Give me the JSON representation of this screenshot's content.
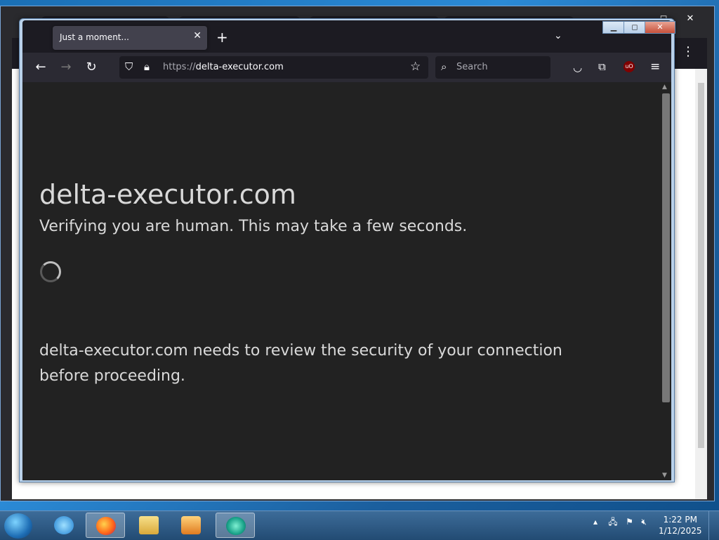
{
  "browser": {
    "tab": {
      "title": "Just a moment..."
    },
    "url": {
      "protocol": "https://",
      "domain": "delta-executor.com"
    },
    "search": {
      "placeholder": "Search"
    }
  },
  "page": {
    "heading": "delta-executor.com",
    "subheading": "Verifying you are human. This may take a few seconds.",
    "note": "delta-executor.com needs to review the security of your connection before proceeding."
  },
  "taskbar": {
    "clock_time": "1:22 PM",
    "clock_date": "1/12/2025"
  },
  "icons": {
    "back": "arrow-left-icon",
    "forward": "arrow-right-icon",
    "reload": "reload-icon",
    "shield": "shield-icon",
    "lock": "lock-icon",
    "bookmark": "star-icon",
    "search": "search-icon",
    "pocket": "pocket-icon",
    "extensions": "puzzle-icon",
    "ublock": "ublock-icon",
    "menu": "hamburger-menu-icon"
  },
  "colors": {
    "page_background": "#222222",
    "toolbar": "#2b2a33",
    "text": "#d9d9d9"
  }
}
